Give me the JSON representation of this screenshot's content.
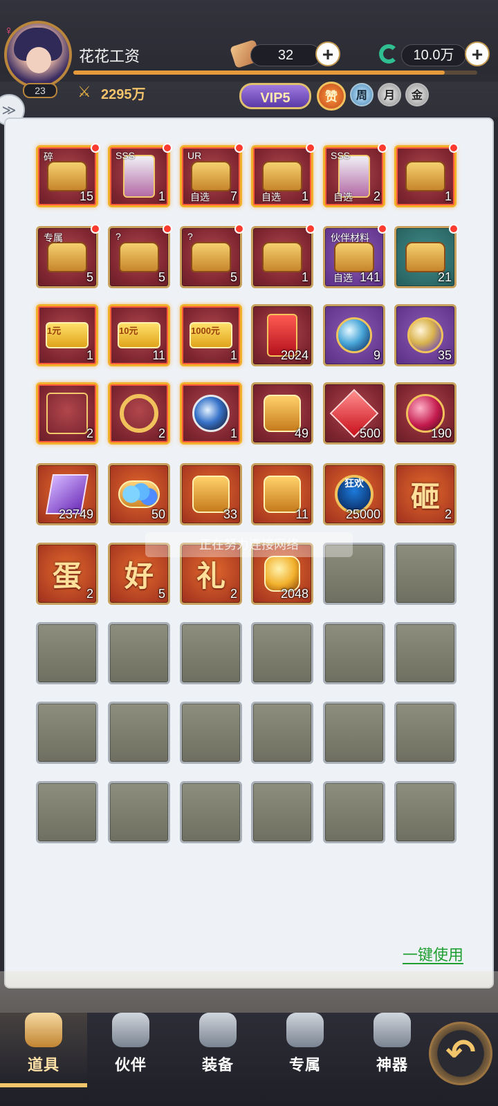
{
  "player": {
    "gender_symbol": "♀",
    "level": "23",
    "name": "花花工资",
    "power": "2295万",
    "vip": "VIP5",
    "exp_progress": 0.92
  },
  "currencies": {
    "ticket_count": "32",
    "green_currency": "10.0万",
    "plus_glyph": "+"
  },
  "badges": {
    "zan": "赞",
    "zhou": "周",
    "yue": "月",
    "jin": "金"
  },
  "inventory": {
    "rows": [
      [
        {
          "count": "15",
          "type": "chest",
          "tag": "碎",
          "frame": "gold",
          "dot": true
        },
        {
          "count": "1",
          "type": "card",
          "tag": "SSS",
          "frame": "gold",
          "dot": true
        },
        {
          "count": "7",
          "type": "chest",
          "tag": "UR",
          "label": "自选",
          "frame": "gold",
          "dot": true
        },
        {
          "count": "1",
          "type": "chest",
          "label": "自选",
          "frame": "gold",
          "dot": true
        },
        {
          "count": "2",
          "type": "card",
          "tag": "SSS",
          "label": "自选",
          "frame": "gold",
          "dot": true
        },
        {
          "count": "1",
          "type": "chest",
          "frame": "gold",
          "dot": true
        }
      ],
      [
        {
          "count": "5",
          "type": "chest",
          "tag": "专属",
          "frame": "item",
          "dot": true
        },
        {
          "count": "5",
          "type": "chest",
          "tag": "?",
          "frame": "item",
          "dot": true
        },
        {
          "count": "5",
          "type": "chest",
          "tag": "?",
          "frame": "item",
          "dot": true
        },
        {
          "count": "1",
          "type": "chest",
          "frame": "item",
          "dot": true
        },
        {
          "count": "141",
          "type": "chest",
          "tag": "伙伴材料",
          "label": "自选",
          "frame": "purple",
          "dot": true
        },
        {
          "count": "21",
          "type": "chest",
          "frame": "teal",
          "dot": true
        }
      ],
      [
        {
          "count": "1",
          "type": "ticket",
          "text": "1元",
          "frame": "gold"
        },
        {
          "count": "11",
          "type": "ticket",
          "text": "10元",
          "frame": "gold"
        },
        {
          "count": "1",
          "type": "ticket",
          "text": "1000元",
          "frame": "gold"
        },
        {
          "count": "2024",
          "type": "redenv",
          "frame": "item"
        },
        {
          "count": "9",
          "type": "orb",
          "frame": "purple"
        },
        {
          "count": "35",
          "type": "orb2",
          "frame": "purple"
        }
      ],
      [
        {
          "count": "2",
          "type": "frame",
          "frame": "gold"
        },
        {
          "count": "2",
          "type": "ring",
          "frame": "gold"
        },
        {
          "count": "1",
          "type": "yin",
          "frame": "gold"
        },
        {
          "count": "49",
          "type": "badgeg",
          "frame": "item"
        },
        {
          "count": "500",
          "type": "gem",
          "frame": "item"
        },
        {
          "count": "190",
          "type": "bomb",
          "frame": "item"
        }
      ],
      [
        {
          "count": "23749",
          "type": "crystal",
          "frame": "orange"
        },
        {
          "count": "50",
          "type": "pearls",
          "frame": "orange"
        },
        {
          "count": "33",
          "type": "badgeg",
          "frame": "orange"
        },
        {
          "count": "11",
          "type": "badgeg",
          "frame": "orange"
        },
        {
          "count": "25000",
          "type": "medal",
          "text": "狂欢",
          "frame": "orange"
        },
        {
          "count": "2",
          "type": "char",
          "text": "砸",
          "frame": "orange"
        }
      ],
      [
        {
          "count": "2",
          "type": "char",
          "text": "蛋",
          "frame": "orange"
        },
        {
          "count": "5",
          "type": "char",
          "text": "好",
          "frame": "orange"
        },
        {
          "count": "2",
          "type": "char",
          "text": "礼",
          "frame": "orange"
        },
        {
          "count": "2048",
          "type": "gold-coin",
          "frame": "orange"
        },
        {
          "empty": true
        },
        {
          "empty": true
        }
      ],
      [
        {
          "empty": true
        },
        {
          "empty": true
        },
        {
          "empty": true
        },
        {
          "empty": true
        },
        {
          "empty": true
        },
        {
          "empty": true
        }
      ],
      [
        {
          "empty": true
        },
        {
          "empty": true
        },
        {
          "empty": true
        },
        {
          "empty": true
        },
        {
          "empty": true
        },
        {
          "empty": true
        }
      ],
      [
        {
          "empty": true
        },
        {
          "empty": true
        },
        {
          "empty": true
        },
        {
          "empty": true
        },
        {
          "empty": true
        },
        {
          "empty": true
        }
      ]
    ]
  },
  "overlay_text": "正在努力连接网络",
  "actions": {
    "one_key_use": "一键使用"
  },
  "bottom_tabs": [
    {
      "label": "道具",
      "active": true
    },
    {
      "label": "伙伴",
      "active": false
    },
    {
      "label": "装备",
      "active": false
    },
    {
      "label": "专属",
      "active": false
    },
    {
      "label": "神器",
      "active": false
    }
  ],
  "back_glyph": "↶",
  "side_glyph": "≫"
}
